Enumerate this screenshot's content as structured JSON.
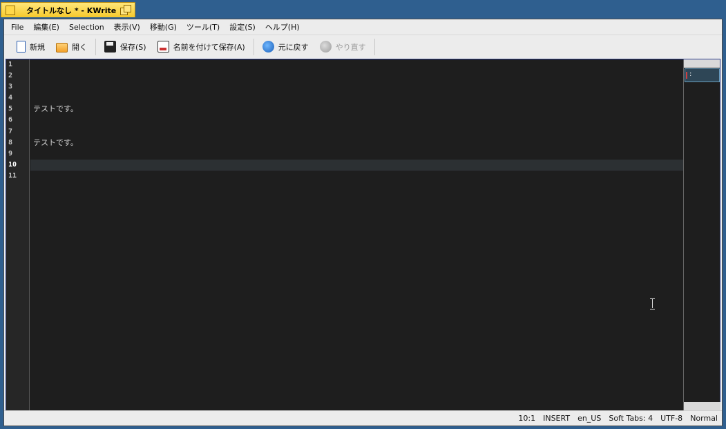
{
  "window": {
    "title": "タイトルなし * - KWrite"
  },
  "menu": [
    "File",
    "編集(E)",
    "Selection",
    "表示(V)",
    "移動(G)",
    "ツール(T)",
    "設定(S)",
    "ヘルプ(H)"
  ],
  "toolbar": {
    "new_label": "新規",
    "open_label": "開く",
    "save_label": "保存(S)",
    "saveas_label": "名前を付けて保存(A)",
    "undo_label": "元に戻す",
    "redo_label": "やり直す"
  },
  "editor": {
    "line_numbers": [
      "1",
      "2",
      "3",
      "4",
      "5",
      "6",
      "7",
      "8",
      "9",
      "10",
      "11"
    ],
    "lines": [
      "",
      "",
      "",
      "",
      "テストです。",
      "",
      "",
      "テストです。",
      "",
      "",
      ""
    ],
    "current_line": 10
  },
  "minimap": {
    "marker": ":"
  },
  "status": {
    "position": "10:1",
    "mode": "INSERT",
    "dictionary": "en_US",
    "indent": "Soft Tabs: 4",
    "encoding": "UTF-8",
    "highlight": "Normal"
  },
  "icons": {
    "new": "new-document-icon",
    "open": "open-folder-icon",
    "save": "save-disk-icon",
    "saveas": "save-as-icon",
    "undo": "undo-icon",
    "redo": "redo-icon"
  }
}
